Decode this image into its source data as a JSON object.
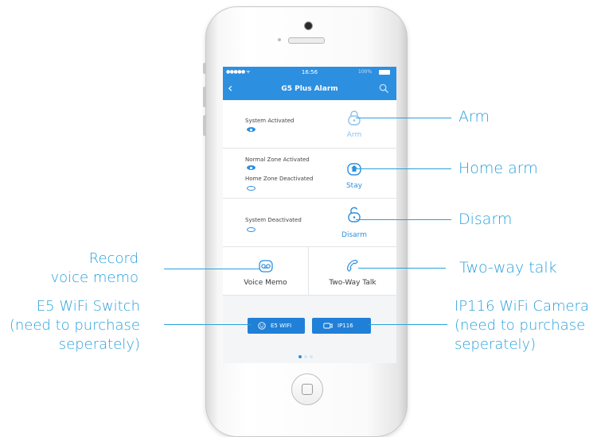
{
  "statusbar": {
    "carrier": "●●●●● ᯤ",
    "time": "16:56",
    "battery": "100%"
  },
  "navbar": {
    "title": "G5 Plus Alarm",
    "back_icon": "chevron-left-icon",
    "search_icon": "search-icon"
  },
  "rows": [
    {
      "status": "System Activated",
      "action_label": "Arm",
      "icon": "lock-icon"
    },
    {
      "status_1": "Normal Zone Activated",
      "status_2": "Home Zone Deactivated",
      "action_label": "Stay",
      "icon": "home-lock-icon"
    },
    {
      "status": "System Deactivated",
      "action_label": "Disarm",
      "icon": "unlock-icon"
    }
  ],
  "grid": {
    "voice_memo": {
      "label": "Voice Memo",
      "icon": "voicemail-icon"
    },
    "two_way_talk": {
      "label": "Two-Way Talk",
      "icon": "phone-icon"
    }
  },
  "buttons": {
    "e5": {
      "label": "E5 WIFI",
      "icon": "smiley-icon"
    },
    "ip116": {
      "label": "IP116",
      "icon": "camera-icon"
    }
  },
  "pager": {
    "pages": 3,
    "active": 0
  },
  "callouts": {
    "arm": "Arm",
    "home_arm": "Home arm",
    "disarm": "Disarm",
    "two_way": "Two-way talk",
    "record_1": "Record",
    "record_2": "voice memo",
    "e5_1": "E5 WiFi Switch",
    "e5_2": "(need to purchase",
    "e5_3": "seperately)",
    "ip_1": "IP116 WiFi Camera",
    "ip_2": "(need to purchase",
    "ip_3": "seperately)"
  },
  "colors": {
    "accent": "#2d8fe0",
    "callout": "#2aa0dc",
    "button": "#2080d8"
  }
}
